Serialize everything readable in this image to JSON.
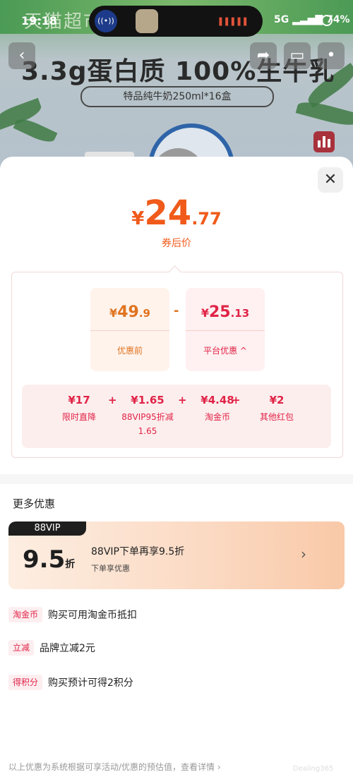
{
  "status_bar": {
    "time": "19:18",
    "signal": "5G",
    "battery": "74%"
  },
  "background": {
    "banner_text": "天猫超市 官 极速送达",
    "headline": "3.3g蛋白质  100%生牛乳",
    "pill": "特品纯牛奶250ml*16盒"
  },
  "sheet": {
    "close_icon": "close-icon",
    "price": {
      "currency": "¥",
      "integer": "24",
      "decimal": ".77"
    },
    "price_label": "券后价",
    "before": {
      "currency": "¥",
      "integer": "49",
      "decimal": ".9",
      "label": "优惠前"
    },
    "minus": "-",
    "platform": {
      "currency": "¥",
      "integer": "25",
      "decimal": ".13",
      "label": "平台优惠 ^"
    },
    "breakdown": [
      {
        "value": "¥17",
        "label": "限时直降"
      },
      {
        "value": "¥1.65",
        "label": "88VIP95折减1.65"
      },
      {
        "value": "¥4.48",
        "label": "淘金币"
      },
      {
        "value": "¥2",
        "label": "其他红包"
      }
    ],
    "plus": "+",
    "more_title": "更多优惠",
    "vip": {
      "tag": "88VIP",
      "discount_number": "9.5",
      "discount_unit": "折",
      "line": "88VIP下单再享9.5折",
      "sub": "下单享优惠",
      "arrow_icon": "chevron-right-icon"
    },
    "promos": [
      {
        "tag": "淘金币",
        "text": "购买可用淘金币抵扣"
      },
      {
        "tag": "立减",
        "text": "品牌立减2元"
      },
      {
        "tag": "得积分",
        "text": "购买预计可得2积分"
      }
    ],
    "footnote": "以上优惠为系统根据可享活动/优惠的预估值，查看详情 ›",
    "watermark": "Dealing365"
  },
  "colors": {
    "accent_orange": "#f05a1a",
    "accent_red": "#e02447",
    "vip_dark": "#1e1e1e"
  }
}
